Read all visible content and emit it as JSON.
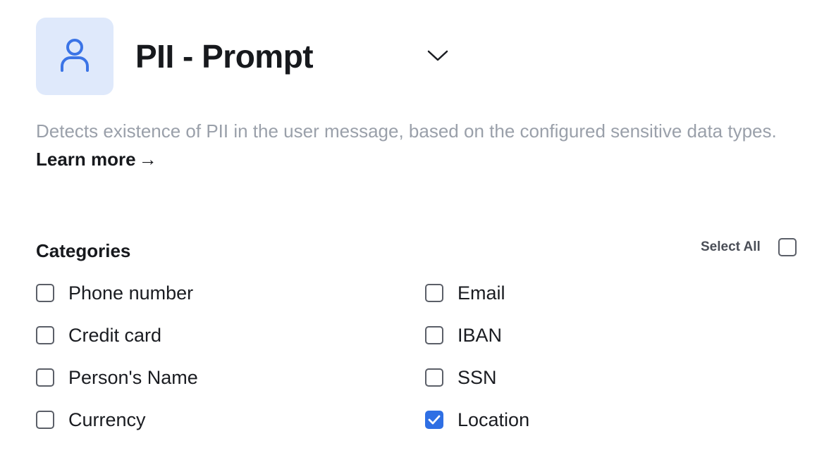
{
  "header": {
    "title": "PII - Prompt",
    "icon": "user-icon",
    "accent": "#3b74e6",
    "tile_color": "#dfe9fb"
  },
  "description": {
    "text": "Detects existence of PII in the user message, based on the configured sensitive data types.",
    "link_label": "Learn more",
    "link_arrow": "→"
  },
  "categories": {
    "title": "Categories",
    "select_all_label": "Select All",
    "select_all_checked": false,
    "items": [
      {
        "label": "Phone number",
        "checked": false
      },
      {
        "label": "Credit card",
        "checked": false
      },
      {
        "label": "Person's Name",
        "checked": false
      },
      {
        "label": "Currency",
        "checked": false
      },
      {
        "label": "Email",
        "checked": false
      },
      {
        "label": "IBAN",
        "checked": false
      },
      {
        "label": "SSN",
        "checked": false
      },
      {
        "label": "Location",
        "checked": true
      }
    ],
    "checked_color": "#2f6fe4"
  }
}
